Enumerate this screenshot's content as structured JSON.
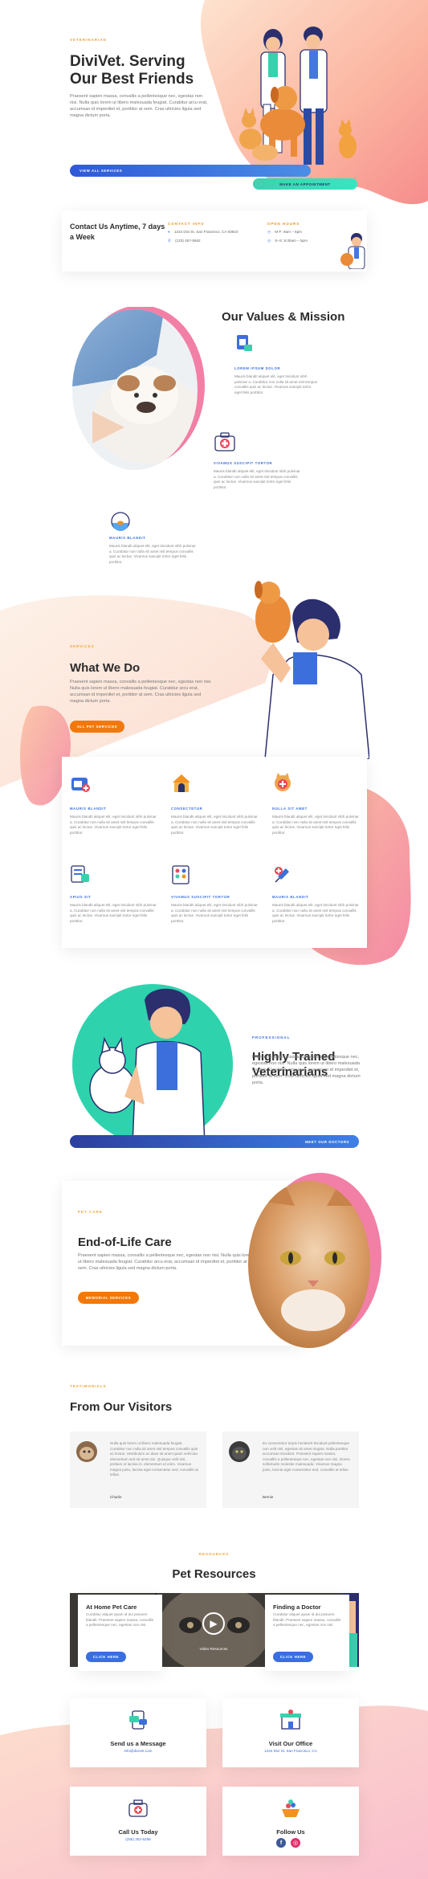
{
  "hero": {
    "eyebrow": "VETERINARIAN",
    "title_line1": "DiviVet. Serving",
    "title_line2": "Our Best Friends",
    "text": "Praesent sapien massa, convallis a pellentesque nec, egestas non nisi. Nulla quis lorem ut libero malesuada feugiat. Curabitur arcu erat, accumsan id imperdiet et, porttitor at sem. Cras ultricies ligula sed magna dictum porta.",
    "btn_services": "VIEW ALL SERVICES",
    "btn_appointment": "MAKE AN APPOINTMENT"
  },
  "contact_bar": {
    "title": "Contact Us Anytime, 7 days a Week",
    "contact_label": "CONTACT INFO",
    "address": "1234 Divi St. San Francisco, CA 93923",
    "phone": "(123) 457-5662",
    "hours_label": "OPEN HOURS",
    "hours_1": "M-F: 9am – 6pm",
    "hours_2": "S–S: 9:30am – 5pm"
  },
  "values": {
    "title": "Our Values & Mission",
    "items": [
      {
        "label": "LOREM IPSUM DOLOR",
        "text": "Mauris blandit aliquet elit, eget tincidunt nibh pulvinar a. Curabitur non nulla sit amet nisl tempus convallis quis ac lectus. Vivamus suscipit tortor eget felis porttitor."
      },
      {
        "label": "VIVAMUS SUSCIPIT TORTOR",
        "text": "Mauris blandit aliquet elit, eget tincidunt nibh pulvinar a. Curabitur non nulla sit amet nisl tempus convallis quis ac lectus. Vivamus suscipit tortor eget felis porttitor."
      },
      {
        "label": "MAURIS BLANDIT",
        "text": "Mauris blandit aliquet elit, eget tincidunt nibh pulvinar a. Curabitur non nulla sit amet nisl tempus convallis quis ac lectus. Vivamus suscipit tortor eget felis porttitor."
      }
    ]
  },
  "what_we_do": {
    "eyebrow": "SERVICES",
    "title": "What We Do",
    "text": "Praesent sapien massa, convallis a pellentesque nec, egestas non nisi. Nulla quis lorem ut libero malesuada feugiat. Curabitur arcu erat, accumsan id imperdiet et, porttitor at sem. Cras ultricies ligula sed magna dictum porta.",
    "button": "ALL PET SERVICES"
  },
  "services": [
    {
      "label": "MAURIS BLANDIT",
      "text": "Mauris blandit aliquet elit, eget tincidunt nibh pulvinar a. Curabitur non nulla sit amet nisl tempus convallis quis ac lectus. Vivamus suscipit tortor eget felis porttitor."
    },
    {
      "label": "CONSECTETUR",
      "text": "Mauris blandit aliquet elit, eget tincidunt nibh pulvinar a. Curabitur non nulla sit amet nisl tempus convallis quis ac lectus. Vivamus suscipit tortor eget felis porttitor."
    },
    {
      "label": "NULLA SIT AMET",
      "text": "Mauris blandit aliquet elit, eget tincidunt nibh pulvinar a. Curabitur non nulla sit amet nisl tempus convallis quis ac lectus. Vivamus suscipit tortor eget felis porttitor."
    },
    {
      "label": "APIUS SIT",
      "text": "Mauris blandit aliquet elit, eget tincidunt nibh pulvinar a. Curabitur non nulla sit amet nisl tempus convallis quis ac lectus. Vivamus suscipit tortor eget felis porttitor."
    },
    {
      "label": "VIVAMUS SUSCIPIT TORTOR",
      "text": "Mauris blandit aliquet elit, eget tincidunt nibh pulvinar a. Curabitur non nulla sit amet nisl tempus convallis quis ac lectus. Vivamus suscipit tortor eget felis porttitor."
    },
    {
      "label": "MAURIS BLANDIT",
      "text": "Mauris blandit aliquet elit, eget tincidunt nibh pulvinar a. Curabitur non nulla sit amet nisl tempus convallis quis ac lectus. Vivamus suscipit tortor eget felis porttitor."
    }
  ],
  "vets": {
    "eyebrow": "PROFESSIONAL",
    "title_line1": "Highly Trained",
    "title_line2": "Veterinarians",
    "text": "Praesent sapien massa, convallis a pellentesque nec, egestas non nisi. Nulla quis lorem ut libero malesuada feugiat. Curabitur arcu erat, accumsan id imperdiet et, porttitor at sem. Cras ultricies ligula sed magna dictum porta.",
    "button": "MEET OUR DOCTORS"
  },
  "eol": {
    "eyebrow": "PET CARE",
    "title": "End-of-Life Care",
    "text": "Praesent sapien massa, convallis a pellentesque nec, egestas non nisi. Nulla quis lorem ut libero malesuada feugiat. Curabitur arcu erat, accumsan id imperdiet et, porttitor at sem. Cras ultricies ligula sed magna dictum porta.",
    "button": "MEMORIAL SERVICES"
  },
  "testimonials": {
    "eyebrow": "TESTIMONIALS",
    "title": "From Our Visitors",
    "items": [
      {
        "text": "Nulla quis lorem ut libero malesuada feugiat. Curabitur non nulla sit amet nisl tempus convallis quis ac lectus. Vestibulum ac diam sit amet quam vehicula elementum sed sit amet dui. Quisque velit nisi, pretium ut lacinia in, elementum id enim. Vivamus magna justo, lacinia eget consectetur sed, convallis at tellus.",
        "name": "Charlie"
      },
      {
        "text": "Ex consectetur turpis hendrerit tincidunt pellentesque non velit nisl, egestas sit amet magna. Nulla porttitor accumsan tincidunt. Praesent sapien massa, convallis a pellentesque nec, egestas non nisi. Donec sollicitudin molestie malesuada. Vivamus magna justo, lacinia eget consectetur sed, convallis at tellus.",
        "name": "Bernie"
      }
    ]
  },
  "resources": {
    "eyebrow": "RESOURCES",
    "title": "Pet Resources",
    "card1_title": "At Home Pet Care",
    "card1_text": "Curabitur aliquet quam id dui posuere blandit. Praesent sapien massa, convallis a pellentesque nec, egestas non nisi.",
    "card1_btn": "CLICK HERE",
    "video_label": "Video Resources",
    "card2_title": "Finding a Doctor",
    "card2_text": "Curabitur aliquet quam id dui posuere blandit. Praesent sapien massa, convallis a pellentesque nec, egestas non nisi.",
    "card2_btn": "CLICK HERE"
  },
  "contact_cards": [
    {
      "title": "Send us a Message",
      "sub": "info@divivet.com"
    },
    {
      "title": "Visit Our Office",
      "sub": "1234 Divi St. San Francisco, CA"
    },
    {
      "title": "Call Us Today",
      "sub": "(255) 352-6258"
    },
    {
      "title": "Follow Us",
      "sub": ""
    }
  ],
  "colors": {
    "accent_orange": "#f29222",
    "accent_blue": "#3a6ee0",
    "accent_teal": "#35d6b8",
    "accent_pink": "#f57ea3"
  }
}
